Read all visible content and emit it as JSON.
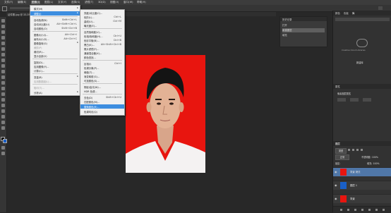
{
  "menubar": {
    "items": [
      {
        "label": "文件(F)"
      },
      {
        "label": "编辑(E)"
      },
      {
        "label": "图像(I)",
        "active": true
      },
      {
        "label": "图层(L)"
      },
      {
        "label": "文字(Y)"
      },
      {
        "label": "选择(S)"
      },
      {
        "label": "滤镜(T)"
      },
      {
        "label": "3D(D)"
      },
      {
        "label": "视图(V)"
      },
      {
        "label": "窗口(W)"
      },
      {
        "label": "帮助(H)"
      }
    ]
  },
  "document_tab": {
    "title": "证件照.jpg @ 33.3%(RGB/8)"
  },
  "image_menu": {
    "rows": [
      {
        "label": "模式(M)",
        "shortcut": "",
        "submenu": true
      },
      {
        "label": "调整(J)",
        "shortcut": "",
        "submenu": true,
        "highlight": true
      },
      {
        "label": "自动色调(N)",
        "shortcut": "Shift+Ctrl+L"
      },
      {
        "label": "自动对比度(U)",
        "shortcut": "Alt+Shift+Ctrl+L"
      },
      {
        "label": "自动颜色(O)",
        "shortcut": "Shift+Ctrl+B"
      },
      {
        "label": "图像大小(I)...",
        "shortcut": "Alt+Ctrl+I"
      },
      {
        "label": "画布大小(S)...",
        "shortcut": "Alt+Ctrl+C"
      },
      {
        "label": "图像旋转(G)",
        "shortcut": "",
        "submenu": true
      },
      {
        "label": "裁剪(P)",
        "shortcut": "",
        "disabled": true
      },
      {
        "label": "裁切(R)...",
        "shortcut": ""
      },
      {
        "label": "显示全部(V)",
        "shortcut": ""
      },
      {
        "label": "复制(D)...",
        "shortcut": ""
      },
      {
        "label": "应用图像(Y)...",
        "shortcut": ""
      },
      {
        "label": "计算(C)...",
        "shortcut": ""
      },
      {
        "label": "变量(B)",
        "shortcut": "",
        "submenu": true
      },
      {
        "label": "应用数据组(L)...",
        "shortcut": "",
        "disabled": true
      },
      {
        "label": "陷印(T)...",
        "shortcut": "",
        "disabled": true
      },
      {
        "label": "分析(A)",
        "shortcut": "",
        "submenu": true
      }
    ]
  },
  "adjust_menu": {
    "rows": [
      {
        "label": "亮度/对比度(C)...",
        "shortcut": ""
      },
      {
        "label": "色阶(L)...",
        "shortcut": "Ctrl+L"
      },
      {
        "label": "曲线(U)...",
        "shortcut": "Ctrl+M"
      },
      {
        "label": "曝光度(E)...",
        "shortcut": ""
      },
      {
        "label": "自然饱和度(V)...",
        "shortcut": ""
      },
      {
        "label": "色相/饱和度(H)...",
        "shortcut": "Ctrl+U"
      },
      {
        "label": "色彩平衡(B)...",
        "shortcut": "Ctrl+B"
      },
      {
        "label": "黑白(K)...",
        "shortcut": "Alt+Shift+Ctrl+B"
      },
      {
        "label": "照片滤镜(F)...",
        "shortcut": ""
      },
      {
        "label": "通道混合器(X)...",
        "shortcut": ""
      },
      {
        "label": "颜色查找...",
        "shortcut": ""
      },
      {
        "label": "反相(I)",
        "shortcut": "Ctrl+I"
      },
      {
        "label": "色调分离(P)...",
        "shortcut": ""
      },
      {
        "label": "阈值(T)...",
        "shortcut": ""
      },
      {
        "label": "渐变映射(G)...",
        "shortcut": ""
      },
      {
        "label": "可选颜色(S)...",
        "shortcut": ""
      },
      {
        "label": "阴影/高光(W)...",
        "shortcut": ""
      },
      {
        "label": "HDR 色调...",
        "shortcut": ""
      },
      {
        "label": "去色(D)",
        "shortcut": "Shift+Ctrl+U"
      },
      {
        "label": "匹配颜色(M)...",
        "shortcut": ""
      },
      {
        "label": "替换颜色(R)...",
        "shortcut": "",
        "highlight": true
      },
      {
        "label": "色调均化(Q)",
        "shortcut": ""
      }
    ]
  },
  "history_panel": {
    "title": "历史记录",
    "rows": [
      {
        "label": "打开"
      },
      {
        "label": "新建图层",
        "selected": true
      },
      {
        "label": "填充"
      }
    ]
  },
  "right_panel": {
    "tabs": [
      "颜色",
      "色板",
      "库"
    ],
    "cloud_caption": "Creative Cloud Libraries",
    "libraries_label": "新建库",
    "properties_title": "属性",
    "properties_sub": "像素图层属性",
    "layers_title": "图层",
    "layer_filter": "类型",
    "blend_mode": "正常",
    "opacity_label": "不透明度: 100%",
    "lock_label": "锁定:",
    "fill_label": "填充: 100%",
    "layers": [
      {
        "name": "背景 拷贝",
        "selected": true
      },
      {
        "name": "图层 1"
      },
      {
        "name": "背景"
      }
    ]
  },
  "colors": {
    "photo_bg": "#e8150f",
    "menu_highlight": "#3d8ee0",
    "layer_select": "#5077a8"
  }
}
